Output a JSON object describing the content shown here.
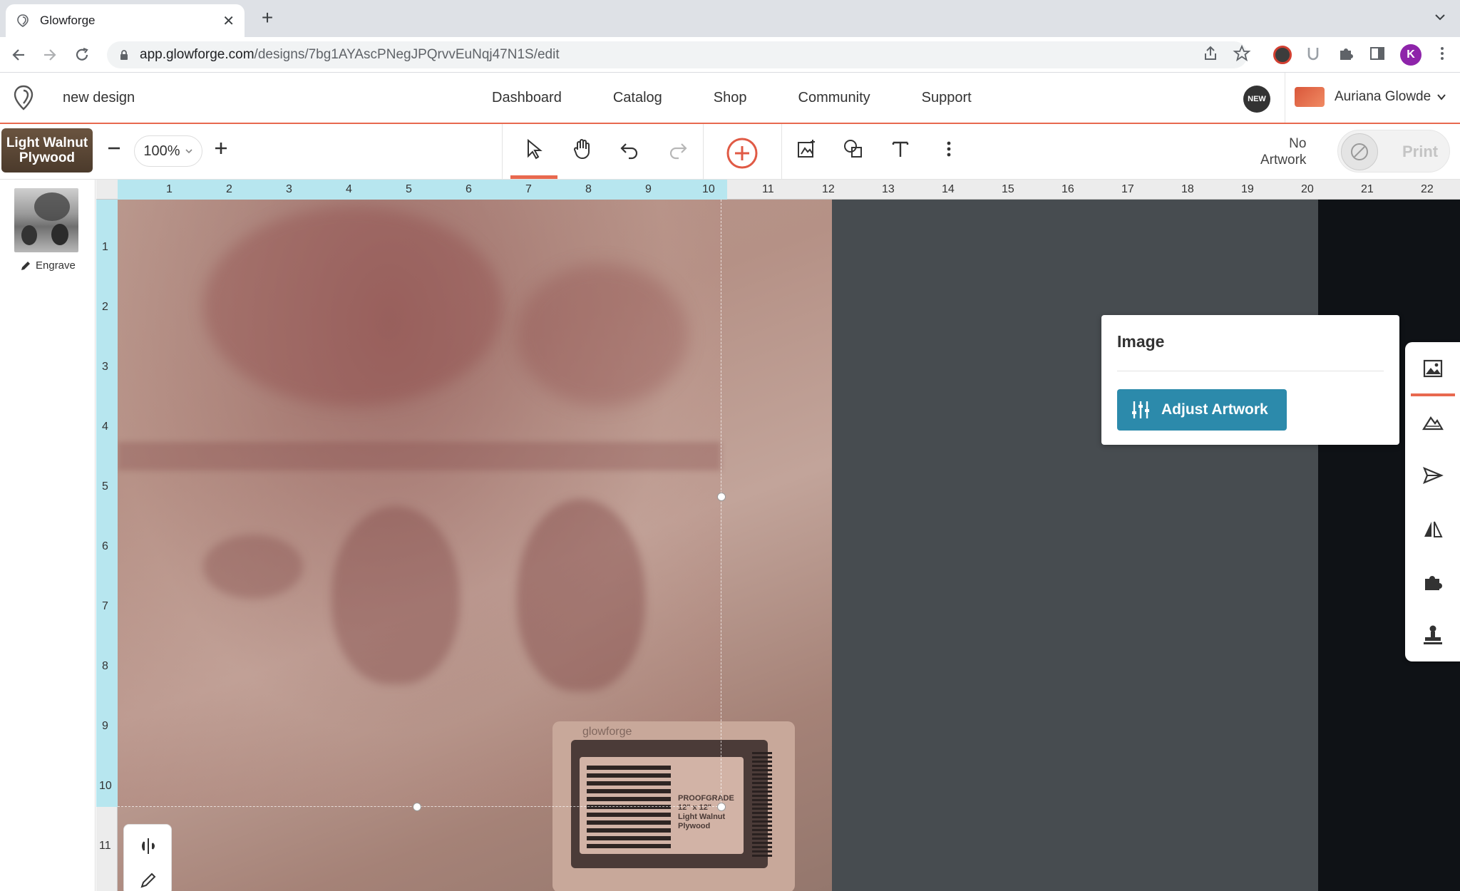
{
  "browser": {
    "tab_title": "Glowforge",
    "url_host": "app.glowforge.com",
    "url_path": "/designs/7bg1AYAscPNegJPQrvvEuNqj47N1S/edit",
    "avatar_letter": "K"
  },
  "header": {
    "design_name": "new design",
    "nav": [
      "Dashboard",
      "Catalog",
      "Shop",
      "Community",
      "Support"
    ],
    "new_badge": "NEW",
    "user_name": "Auriana Glowde"
  },
  "toolbar": {
    "material_line1": "Light Walnut",
    "material_line2": "Plywood",
    "zoom": "100%",
    "no_artwork_line1": "No",
    "no_artwork_line2": "Artwork",
    "print_label": "Print"
  },
  "left_panel": {
    "operation_label": "Engrave"
  },
  "ruler": {
    "top": [
      "1",
      "2",
      "3",
      "4",
      "5",
      "6",
      "7",
      "8",
      "9",
      "10",
      "11",
      "12",
      "13",
      "14",
      "15",
      "16",
      "17",
      "18",
      "19",
      "20",
      "21",
      "22"
    ],
    "left": [
      "1",
      "2",
      "3",
      "4",
      "5",
      "6",
      "7",
      "8",
      "9",
      "10",
      "11"
    ]
  },
  "canvas": {
    "label_brand": "glowforge",
    "label_size": "12\" x 12\"",
    "label_material_1": "Light Walnut",
    "label_material_2": "Plywood",
    "label_grade": "PROOFGRADE"
  },
  "image_panel": {
    "title": "Image",
    "adjust_button": "Adjust Artwork"
  },
  "colors": {
    "accent": "#e8694f",
    "button_blue": "#2c8aab",
    "canvas_bg": "#474c50"
  }
}
